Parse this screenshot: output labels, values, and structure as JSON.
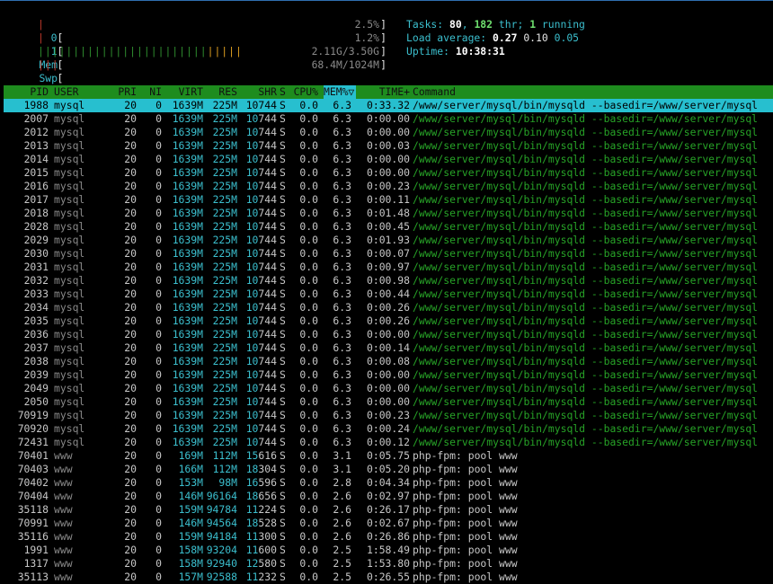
{
  "meters": {
    "cpu0": {
      "label": "0",
      "value": "2.5%",
      "fill_fraction": 0.03
    },
    "cpu1": {
      "label": "1",
      "value": "1.2%",
      "fill_fraction": 0.015
    },
    "mem": {
      "label": "Mem",
      "value": "2.11G/3.50G",
      "used_fraction": 0.6
    },
    "swp": {
      "label": "Swp",
      "value": "68.4M/1024M",
      "used_fraction": 0.067
    }
  },
  "info": {
    "tasks_label": "Tasks: ",
    "tasks": "80",
    "thr": "182",
    "thr_label": " thr; ",
    "running": "1",
    "running_label": " running",
    "load_label": "Load average: ",
    "load1": "0.27",
    "load5": "0.10",
    "load15": "0.05",
    "uptime_label": "Uptime: ",
    "uptime": "10:38:31"
  },
  "columns": {
    "pid": "PID",
    "user": "USER",
    "pri": "PRI",
    "ni": "NI",
    "virt": "VIRT",
    "res": "RES",
    "shr": "SHR",
    "s": "S",
    "cpu": "CPU%",
    "mem": "MEM%▽",
    "time": "TIME+",
    "cmd": "Command"
  },
  "processes": [
    {
      "pid": "1988",
      "user": "mysql",
      "pri": "20",
      "ni": "0",
      "virt": "1639M",
      "res": "225M",
      "shr_k": "10",
      "shr_r": "744",
      "s": "S",
      "cpu": "0.0",
      "mem": "6.3",
      "time": "0:33.32",
      "cmd": "/www/server/mysql/bin/mysqld --basedir=/www/server/mysql",
      "thread": false,
      "selected": true
    },
    {
      "pid": "2007",
      "user": "mysql",
      "pri": "20",
      "ni": "0",
      "virt": "1639M",
      "res": "225M",
      "shr_k": "10",
      "shr_r": "744",
      "s": "S",
      "cpu": "0.0",
      "mem": "6.3",
      "time": "0:00.00",
      "cmd": "/www/server/mysql/bin/mysqld --basedir=/www/server/mysql",
      "thread": true
    },
    {
      "pid": "2012",
      "user": "mysql",
      "pri": "20",
      "ni": "0",
      "virt": "1639M",
      "res": "225M",
      "shr_k": "10",
      "shr_r": "744",
      "s": "S",
      "cpu": "0.0",
      "mem": "6.3",
      "time": "0:00.00",
      "cmd": "/www/server/mysql/bin/mysqld --basedir=/www/server/mysql",
      "thread": true
    },
    {
      "pid": "2013",
      "user": "mysql",
      "pri": "20",
      "ni": "0",
      "virt": "1639M",
      "res": "225M",
      "shr_k": "10",
      "shr_r": "744",
      "s": "S",
      "cpu": "0.0",
      "mem": "6.3",
      "time": "0:00.03",
      "cmd": "/www/server/mysql/bin/mysqld --basedir=/www/server/mysql",
      "thread": true
    },
    {
      "pid": "2014",
      "user": "mysql",
      "pri": "20",
      "ni": "0",
      "virt": "1639M",
      "res": "225M",
      "shr_k": "10",
      "shr_r": "744",
      "s": "S",
      "cpu": "0.0",
      "mem": "6.3",
      "time": "0:00.00",
      "cmd": "/www/server/mysql/bin/mysqld --basedir=/www/server/mysql",
      "thread": true
    },
    {
      "pid": "2015",
      "user": "mysql",
      "pri": "20",
      "ni": "0",
      "virt": "1639M",
      "res": "225M",
      "shr_k": "10",
      "shr_r": "744",
      "s": "S",
      "cpu": "0.0",
      "mem": "6.3",
      "time": "0:00.00",
      "cmd": "/www/server/mysql/bin/mysqld --basedir=/www/server/mysql",
      "thread": true
    },
    {
      "pid": "2016",
      "user": "mysql",
      "pri": "20",
      "ni": "0",
      "virt": "1639M",
      "res": "225M",
      "shr_k": "10",
      "shr_r": "744",
      "s": "S",
      "cpu": "0.0",
      "mem": "6.3",
      "time": "0:00.23",
      "cmd": "/www/server/mysql/bin/mysqld --basedir=/www/server/mysql",
      "thread": true
    },
    {
      "pid": "2017",
      "user": "mysql",
      "pri": "20",
      "ni": "0",
      "virt": "1639M",
      "res": "225M",
      "shr_k": "10",
      "shr_r": "744",
      "s": "S",
      "cpu": "0.0",
      "mem": "6.3",
      "time": "0:00.11",
      "cmd": "/www/server/mysql/bin/mysqld --basedir=/www/server/mysql",
      "thread": true
    },
    {
      "pid": "2018",
      "user": "mysql",
      "pri": "20",
      "ni": "0",
      "virt": "1639M",
      "res": "225M",
      "shr_k": "10",
      "shr_r": "744",
      "s": "S",
      "cpu": "0.0",
      "mem": "6.3",
      "time": "0:01.48",
      "cmd": "/www/server/mysql/bin/mysqld --basedir=/www/server/mysql",
      "thread": true
    },
    {
      "pid": "2028",
      "user": "mysql",
      "pri": "20",
      "ni": "0",
      "virt": "1639M",
      "res": "225M",
      "shr_k": "10",
      "shr_r": "744",
      "s": "S",
      "cpu": "0.0",
      "mem": "6.3",
      "time": "0:00.45",
      "cmd": "/www/server/mysql/bin/mysqld --basedir=/www/server/mysql",
      "thread": true
    },
    {
      "pid": "2029",
      "user": "mysql",
      "pri": "20",
      "ni": "0",
      "virt": "1639M",
      "res": "225M",
      "shr_k": "10",
      "shr_r": "744",
      "s": "S",
      "cpu": "0.0",
      "mem": "6.3",
      "time": "0:01.93",
      "cmd": "/www/server/mysql/bin/mysqld --basedir=/www/server/mysql",
      "thread": true
    },
    {
      "pid": "2030",
      "user": "mysql",
      "pri": "20",
      "ni": "0",
      "virt": "1639M",
      "res": "225M",
      "shr_k": "10",
      "shr_r": "744",
      "s": "S",
      "cpu": "0.0",
      "mem": "6.3",
      "time": "0:00.07",
      "cmd": "/www/server/mysql/bin/mysqld --basedir=/www/server/mysql",
      "thread": true
    },
    {
      "pid": "2031",
      "user": "mysql",
      "pri": "20",
      "ni": "0",
      "virt": "1639M",
      "res": "225M",
      "shr_k": "10",
      "shr_r": "744",
      "s": "S",
      "cpu": "0.0",
      "mem": "6.3",
      "time": "0:00.97",
      "cmd": "/www/server/mysql/bin/mysqld --basedir=/www/server/mysql",
      "thread": true
    },
    {
      "pid": "2032",
      "user": "mysql",
      "pri": "20",
      "ni": "0",
      "virt": "1639M",
      "res": "225M",
      "shr_k": "10",
      "shr_r": "744",
      "s": "S",
      "cpu": "0.0",
      "mem": "6.3",
      "time": "0:00.98",
      "cmd": "/www/server/mysql/bin/mysqld --basedir=/www/server/mysql",
      "thread": true
    },
    {
      "pid": "2033",
      "user": "mysql",
      "pri": "20",
      "ni": "0",
      "virt": "1639M",
      "res": "225M",
      "shr_k": "10",
      "shr_r": "744",
      "s": "S",
      "cpu": "0.0",
      "mem": "6.3",
      "time": "0:00.44",
      "cmd": "/www/server/mysql/bin/mysqld --basedir=/www/server/mysql",
      "thread": true
    },
    {
      "pid": "2034",
      "user": "mysql",
      "pri": "20",
      "ni": "0",
      "virt": "1639M",
      "res": "225M",
      "shr_k": "10",
      "shr_r": "744",
      "s": "S",
      "cpu": "0.0",
      "mem": "6.3",
      "time": "0:00.26",
      "cmd": "/www/server/mysql/bin/mysqld --basedir=/www/server/mysql",
      "thread": true
    },
    {
      "pid": "2035",
      "user": "mysql",
      "pri": "20",
      "ni": "0",
      "virt": "1639M",
      "res": "225M",
      "shr_k": "10",
      "shr_r": "744",
      "s": "S",
      "cpu": "0.0",
      "mem": "6.3",
      "time": "0:00.26",
      "cmd": "/www/server/mysql/bin/mysqld --basedir=/www/server/mysql",
      "thread": true
    },
    {
      "pid": "2036",
      "user": "mysql",
      "pri": "20",
      "ni": "0",
      "virt": "1639M",
      "res": "225M",
      "shr_k": "10",
      "shr_r": "744",
      "s": "S",
      "cpu": "0.0",
      "mem": "6.3",
      "time": "0:00.00",
      "cmd": "/www/server/mysql/bin/mysqld --basedir=/www/server/mysql",
      "thread": true
    },
    {
      "pid": "2037",
      "user": "mysql",
      "pri": "20",
      "ni": "0",
      "virt": "1639M",
      "res": "225M",
      "shr_k": "10",
      "shr_r": "744",
      "s": "S",
      "cpu": "0.0",
      "mem": "6.3",
      "time": "0:00.14",
      "cmd": "/www/server/mysql/bin/mysqld --basedir=/www/server/mysql",
      "thread": true
    },
    {
      "pid": "2038",
      "user": "mysql",
      "pri": "20",
      "ni": "0",
      "virt": "1639M",
      "res": "225M",
      "shr_k": "10",
      "shr_r": "744",
      "s": "S",
      "cpu": "0.0",
      "mem": "6.3",
      "time": "0:00.08",
      "cmd": "/www/server/mysql/bin/mysqld --basedir=/www/server/mysql",
      "thread": true
    },
    {
      "pid": "2039",
      "user": "mysql",
      "pri": "20",
      "ni": "0",
      "virt": "1639M",
      "res": "225M",
      "shr_k": "10",
      "shr_r": "744",
      "s": "S",
      "cpu": "0.0",
      "mem": "6.3",
      "time": "0:00.00",
      "cmd": "/www/server/mysql/bin/mysqld --basedir=/www/server/mysql",
      "thread": true
    },
    {
      "pid": "2049",
      "user": "mysql",
      "pri": "20",
      "ni": "0",
      "virt": "1639M",
      "res": "225M",
      "shr_k": "10",
      "shr_r": "744",
      "s": "S",
      "cpu": "0.0",
      "mem": "6.3",
      "time": "0:00.00",
      "cmd": "/www/server/mysql/bin/mysqld --basedir=/www/server/mysql",
      "thread": true
    },
    {
      "pid": "2050",
      "user": "mysql",
      "pri": "20",
      "ni": "0",
      "virt": "1639M",
      "res": "225M",
      "shr_k": "10",
      "shr_r": "744",
      "s": "S",
      "cpu": "0.0",
      "mem": "6.3",
      "time": "0:00.00",
      "cmd": "/www/server/mysql/bin/mysqld --basedir=/www/server/mysql",
      "thread": true
    },
    {
      "pid": "70919",
      "user": "mysql",
      "pri": "20",
      "ni": "0",
      "virt": "1639M",
      "res": "225M",
      "shr_k": "10",
      "shr_r": "744",
      "s": "S",
      "cpu": "0.0",
      "mem": "6.3",
      "time": "0:00.23",
      "cmd": "/www/server/mysql/bin/mysqld --basedir=/www/server/mysql",
      "thread": true
    },
    {
      "pid": "70920",
      "user": "mysql",
      "pri": "20",
      "ni": "0",
      "virt": "1639M",
      "res": "225M",
      "shr_k": "10",
      "shr_r": "744",
      "s": "S",
      "cpu": "0.0",
      "mem": "6.3",
      "time": "0:00.24",
      "cmd": "/www/server/mysql/bin/mysqld --basedir=/www/server/mysql",
      "thread": true
    },
    {
      "pid": "72431",
      "user": "mysql",
      "pri": "20",
      "ni": "0",
      "virt": "1639M",
      "res": "225M",
      "shr_k": "10",
      "shr_r": "744",
      "s": "S",
      "cpu": "0.0",
      "mem": "6.3",
      "time": "0:00.12",
      "cmd": "/www/server/mysql/bin/mysqld --basedir=/www/server/mysql",
      "thread": true
    },
    {
      "pid": "70401",
      "user": "www",
      "pri": "20",
      "ni": "0",
      "virt": "169M",
      "res": "112M",
      "shr_k": "15",
      "shr_r": "616",
      "s": "S",
      "cpu": "0.0",
      "mem": "3.1",
      "time": "0:05.75",
      "cmd": "php-fpm: pool www",
      "thread": false
    },
    {
      "pid": "70403",
      "user": "www",
      "pri": "20",
      "ni": "0",
      "virt": "166M",
      "res": "112M",
      "shr_k": "18",
      "shr_r": "304",
      "s": "S",
      "cpu": "0.0",
      "mem": "3.1",
      "time": "0:05.20",
      "cmd": "php-fpm: pool www",
      "thread": false
    },
    {
      "pid": "70402",
      "user": "www",
      "pri": "20",
      "ni": "0",
      "virt": "153M",
      "res": "98M",
      "shr_k": "16",
      "shr_r": "596",
      "s": "S",
      "cpu": "0.0",
      "mem": "2.8",
      "time": "0:04.34",
      "cmd": "php-fpm: pool www",
      "thread": false
    },
    {
      "pid": "70404",
      "user": "www",
      "pri": "20",
      "ni": "0",
      "virt": "146M",
      "res": "96164",
      "shr_k": "18",
      "shr_r": "656",
      "s": "S",
      "cpu": "0.0",
      "mem": "2.6",
      "time": "0:02.97",
      "cmd": "php-fpm: pool www",
      "thread": false
    },
    {
      "pid": "35118",
      "user": "www",
      "pri": "20",
      "ni": "0",
      "virt": "159M",
      "res": "94784",
      "shr_k": "11",
      "shr_r": "224",
      "s": "S",
      "cpu": "0.0",
      "mem": "2.6",
      "time": "0:26.17",
      "cmd": "php-fpm: pool www",
      "thread": false
    },
    {
      "pid": "70991",
      "user": "www",
      "pri": "20",
      "ni": "0",
      "virt": "146M",
      "res": "94564",
      "shr_k": "18",
      "shr_r": "528",
      "s": "S",
      "cpu": "0.0",
      "mem": "2.6",
      "time": "0:02.67",
      "cmd": "php-fpm: pool www",
      "thread": false
    },
    {
      "pid": "35116",
      "user": "www",
      "pri": "20",
      "ni": "0",
      "virt": "159M",
      "res": "94184",
      "shr_k": "11",
      "shr_r": "300",
      "s": "S",
      "cpu": "0.0",
      "mem": "2.6",
      "time": "0:26.86",
      "cmd": "php-fpm: pool www",
      "thread": false
    },
    {
      "pid": "1991",
      "user": "www",
      "pri": "20",
      "ni": "0",
      "virt": "158M",
      "res": "93204",
      "shr_k": "11",
      "shr_r": "600",
      "s": "S",
      "cpu": "0.0",
      "mem": "2.5",
      "time": "1:58.49",
      "cmd": "php-fpm: pool www",
      "thread": false
    },
    {
      "pid": "1317",
      "user": "www",
      "pri": "20",
      "ni": "0",
      "virt": "158M",
      "res": "92940",
      "shr_k": "12",
      "shr_r": "580",
      "s": "S",
      "cpu": "0.0",
      "mem": "2.5",
      "time": "1:53.80",
      "cmd": "php-fpm: pool www",
      "thread": false
    },
    {
      "pid": "35113",
      "user": "www",
      "pri": "20",
      "ni": "0",
      "virt": "157M",
      "res": "92588",
      "shr_k": "11",
      "shr_r": "232",
      "s": "S",
      "cpu": "0.0",
      "mem": "2.5",
      "time": "0:26.55",
      "cmd": "php-fpm: pool www",
      "thread": false
    }
  ]
}
